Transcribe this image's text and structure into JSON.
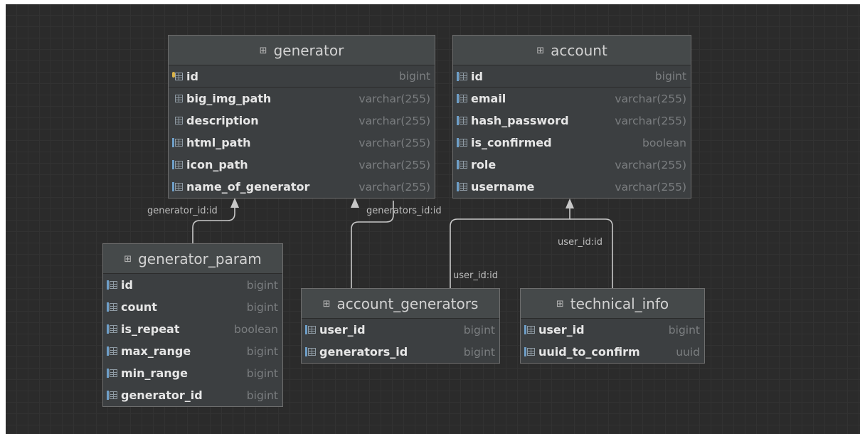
{
  "tables": [
    {
      "id": "generator",
      "name": "generator",
      "columns": [
        {
          "name": "id",
          "type": "bigint",
          "kind": "primary-key"
        },
        {
          "name": "big_img_path",
          "type": "varchar(255)",
          "kind": "column"
        },
        {
          "name": "description",
          "type": "varchar(255)",
          "kind": "column"
        },
        {
          "name": "html_path",
          "type": "varchar(255)",
          "kind": "column"
        },
        {
          "name": "icon_path",
          "type": "varchar(255)",
          "kind": "column"
        },
        {
          "name": "name_of_generator",
          "type": "varchar(255)",
          "kind": "column"
        }
      ]
    },
    {
      "id": "account",
      "name": "account",
      "columns": [
        {
          "name": "id",
          "type": "bigint",
          "kind": "primary-key"
        },
        {
          "name": "email",
          "type": "varchar(255)",
          "kind": "column"
        },
        {
          "name": "hash_password",
          "type": "varchar(255)",
          "kind": "column"
        },
        {
          "name": "is_confirmed",
          "type": "boolean",
          "kind": "column"
        },
        {
          "name": "role",
          "type": "varchar(255)",
          "kind": "column"
        },
        {
          "name": "username",
          "type": "varchar(255)",
          "kind": "column"
        }
      ]
    },
    {
      "id": "generator_param",
      "name": "generator_param",
      "columns": [
        {
          "name": "id",
          "type": "bigint",
          "kind": "column"
        },
        {
          "name": "count",
          "type": "bigint",
          "kind": "column"
        },
        {
          "name": "is_repeat",
          "type": "boolean",
          "kind": "column"
        },
        {
          "name": "max_range",
          "type": "bigint",
          "kind": "column"
        },
        {
          "name": "min_range",
          "type": "bigint",
          "kind": "column"
        },
        {
          "name": "generator_id",
          "type": "bigint",
          "kind": "column"
        }
      ]
    },
    {
      "id": "account_generators",
      "name": "account_generators",
      "columns": [
        {
          "name": "user_id",
          "type": "bigint",
          "kind": "column"
        },
        {
          "name": "generators_id",
          "type": "bigint",
          "kind": "column"
        }
      ]
    },
    {
      "id": "technical_info",
      "name": "technical_info",
      "columns": [
        {
          "name": "user_id",
          "type": "bigint",
          "kind": "column"
        },
        {
          "name": "uuid_to_confirm",
          "type": "uuid",
          "kind": "column"
        }
      ]
    }
  ],
  "relations": [
    {
      "label": "generator_id:id",
      "from": "generator_param",
      "to": "generator"
    },
    {
      "label": "generators_id:id",
      "from": "account_generators",
      "to": "generator"
    },
    {
      "label": "user_id:id",
      "from": "account_generators",
      "to": "account"
    },
    {
      "label": "user_id:id",
      "from": "technical_info",
      "to": "account"
    }
  ],
  "colors": {
    "canvas": "#2b2b2b",
    "table_body": "#3c3f41",
    "table_header": "#45494a",
    "column_name": "#e6e6e6",
    "column_type": "#7b7e80",
    "connector": "#c8c8c8",
    "key_icon": "#d8b24a",
    "column_icon": "#6e9fc9"
  },
  "icons": {
    "table": "table-icon",
    "primary_key": "primary-key-icon",
    "column": "column-icon"
  }
}
